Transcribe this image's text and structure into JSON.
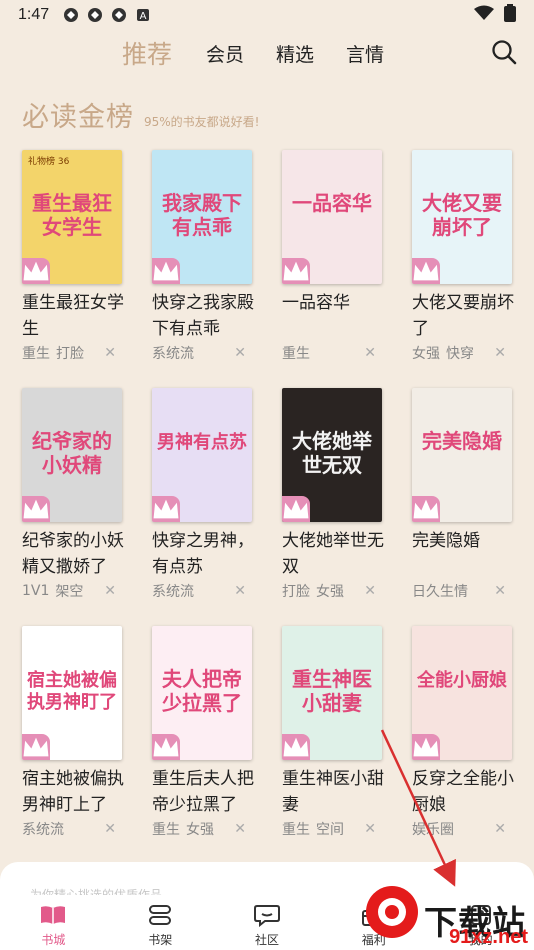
{
  "status_bar": {
    "time": "1:47",
    "icons": [
      "app-icon",
      "app-icon",
      "app-icon",
      "a-icon"
    ],
    "right_icons": [
      "wifi-icon",
      "battery-icon"
    ]
  },
  "top_nav": {
    "tabs": [
      {
        "label": "推荐",
        "active": true
      },
      {
        "label": "会员"
      },
      {
        "label": "精选"
      },
      {
        "label": "言情"
      }
    ],
    "search_icon": "search-icon",
    "accent": "#c8a889"
  },
  "section": {
    "title": "必读金榜",
    "subtitle": "95%的书友都说好看!"
  },
  "books": [
    {
      "title": "重生最狂女学生",
      "tags": [
        "重生",
        "打脸"
      ],
      "cover_text": "重生最狂女学生",
      "cover_badge": "礼物榜 36",
      "cover_color": "#f3d46a"
    },
    {
      "title": "快穿之我家殿下有点乖",
      "tags": [
        "系统流"
      ],
      "cover_text": "我家殿下有点乖",
      "cover_color": "#bfe6f4"
    },
    {
      "title": "一品容华",
      "tags": [
        "重生"
      ],
      "cover_text": "一品容华",
      "cover_color": "#f6e6e8"
    },
    {
      "title": "大佬又要崩坏了",
      "tags": [
        "女强",
        "快穿"
      ],
      "cover_text": "大佬又要崩坏了",
      "cover_color": "#e7f4f8"
    },
    {
      "title": "纪爷家的小妖精又撒娇了",
      "tags": [
        "1V1",
        "架空"
      ],
      "cover_text": "纪爷家的小妖精",
      "cover_color": "#d8d8d8"
    },
    {
      "title": "快穿之男神，有点苏",
      "tags": [
        "系统流"
      ],
      "cover_text": "男神有点苏",
      "cover_color": "#e7def4"
    },
    {
      "title": "大佬她举世无双",
      "tags": [
        "打脸",
        "女强"
      ],
      "cover_text": "大佬她举世无双",
      "cover_color": "#2a2422"
    },
    {
      "title": "完美隐婚",
      "tags": [
        "日久生情"
      ],
      "cover_text": "完美隐婚",
      "cover_color": "#f2ede6"
    },
    {
      "title": "宿主她被偏执男神盯上了",
      "tags": [
        "系统流"
      ],
      "cover_text": "宿主她被偏执男神盯了",
      "cover_color": "#ffffff"
    },
    {
      "title": "重生后夫人把帝少拉黑了",
      "tags": [
        "重生",
        "女强"
      ],
      "cover_text": "夫人把帝少拉黑了",
      "cover_color": "#fdeef3"
    },
    {
      "title": "重生神医小甜妻",
      "tags": [
        "重生",
        "空间"
      ],
      "cover_text": "重生神医小甜妻",
      "cover_color": "#dff1e8"
    },
    {
      "title": "反穿之全能小厨娘",
      "tags": [
        "娱乐圈"
      ],
      "cover_text": "全能小厨娘",
      "cover_color": "#f7e3df"
    }
  ],
  "panel": {
    "hint": "为你精心挑选的优质作品"
  },
  "bottom_nav": [
    {
      "label": "书城",
      "icon": "book-icon",
      "active": true
    },
    {
      "label": "书架",
      "icon": "shelf-icon"
    },
    {
      "label": "社区",
      "icon": "chat-icon"
    },
    {
      "label": "福利",
      "icon": "gift-icon"
    },
    {
      "label": "我的",
      "icon": "profile-icon"
    }
  ],
  "watermark": {
    "text": "下载站",
    "url": "91xz.net"
  }
}
